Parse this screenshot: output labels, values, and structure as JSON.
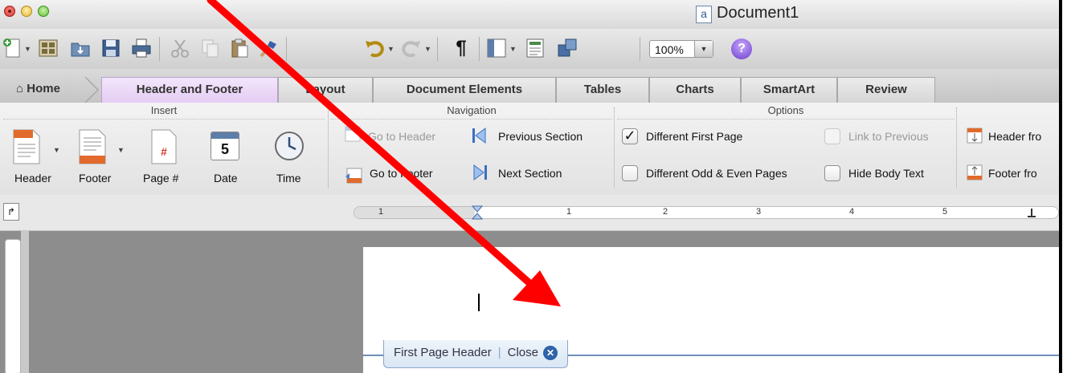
{
  "window": {
    "title": "Document1"
  },
  "toolbar": {
    "zoom": "100%"
  },
  "tabs": [
    {
      "label": "Home"
    },
    {
      "label": "Header and Footer"
    },
    {
      "label": "Layout"
    },
    {
      "label": "Document Elements"
    },
    {
      "label": "Tables"
    },
    {
      "label": "Charts"
    },
    {
      "label": "SmartArt"
    },
    {
      "label": "Review"
    }
  ],
  "ribbon": {
    "insert": {
      "title": "Insert",
      "header": "Header",
      "footer": "Footer",
      "page_number": "Page #",
      "date": "Date",
      "date_icon_number": "5",
      "time": "Time"
    },
    "navigation": {
      "title": "Navigation",
      "go_to_header": "Go to Header",
      "go_to_footer": "Go to Footer",
      "previous_section": "Previous Section",
      "next_section": "Next Section"
    },
    "options": {
      "title": "Options",
      "different_first_page": "Different First Page",
      "different_odd_even": "Different Odd & Even Pages",
      "link_to_previous": "Link to Previous",
      "hide_body_text": "Hide Body Text"
    },
    "position": {
      "header_from_top": "Header fro",
      "footer_from_bottom": "Footer fro"
    }
  },
  "ruler": {
    "marks": [
      "1",
      "1",
      "2",
      "3",
      "4",
      "5"
    ]
  },
  "document": {
    "header_tag": "First Page Header",
    "close_label": "Close"
  },
  "colors": {
    "annotation_arrow": "#ff0000",
    "active_tab": "#e4cdf3",
    "header_boundary": "#6e8fb8"
  }
}
